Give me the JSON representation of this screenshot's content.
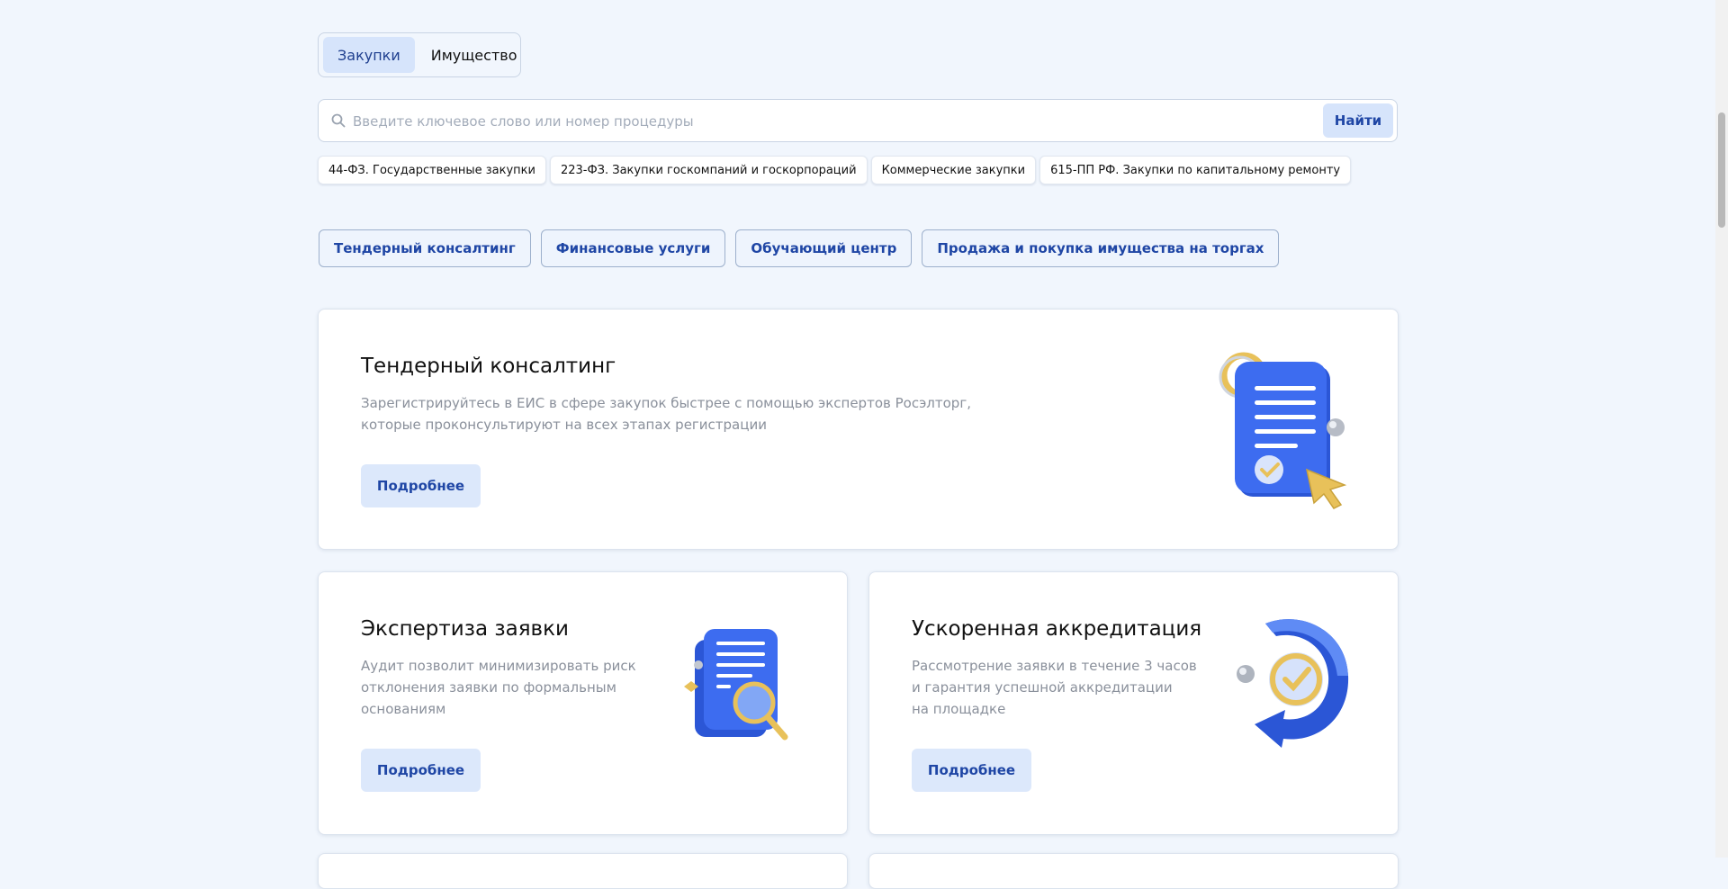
{
  "tabs": [
    {
      "label": "Закупки",
      "active": true
    },
    {
      "label": "Имущество",
      "active": false
    }
  ],
  "search": {
    "placeholder": "Введите ключевое слово или номер процедуры",
    "value": "",
    "button_label": "Найти",
    "icon": "search-icon"
  },
  "law_chips": [
    "44-ФЗ. Государственные закупки",
    "223-ФЗ. Закупки госкомпаний и госкорпораций",
    "Коммерческие закупки",
    "615-ПП РФ. Закупки по капитальному ремонту"
  ],
  "services": [
    "Тендерный консалтинг",
    "Финансовые услуги",
    "Обучающий центр",
    "Продажа и покупка имущества на торгах"
  ],
  "cards": [
    {
      "title": "Тендерный консалтинг",
      "text_lines": [
        "Зарегистрируйтесь в ЕИС в сфере закупок быстрее с помощью экспертов Росэлторг,",
        "которые проконсультируют на всех этапах регистрации"
      ],
      "button": "Подробнее",
      "icon": "document-cursor-icon"
    },
    {
      "title": "Экспертиза заявки",
      "text_lines": [
        "Аудит позволит минимизировать риск",
        "отклонения заявки по формальным",
        "основаниям"
      ],
      "button": "Подробнее",
      "icon": "magnifier-document-icon"
    },
    {
      "title": "Ускоренная аккредитация",
      "text_lines": [
        "Рассмотрение заявки в течение 3 часов",
        "и гарантия успешной аккредитации",
        "на площадке"
      ],
      "button": "Подробнее",
      "icon": "clock-check-icon"
    }
  ],
  "colors": {
    "background": "#f1f6fd",
    "accent": "#1f46a5",
    "accent_light": "#d6e4fb",
    "illustration_blue": "#2f5fe0",
    "illustration_gold": "#e8c15a"
  }
}
